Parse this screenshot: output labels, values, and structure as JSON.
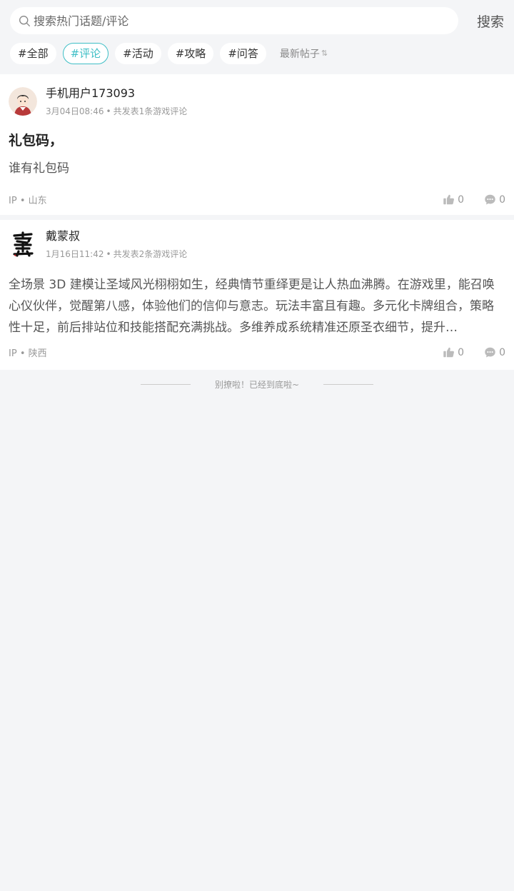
{
  "search": {
    "placeholder": "搜索热门话题/评论",
    "button_label": "搜索"
  },
  "tags": [
    {
      "label": "#全部",
      "active": false
    },
    {
      "label": "#评论",
      "active": true
    },
    {
      "label": "#活动",
      "active": false
    },
    {
      "label": "#攻略",
      "active": false
    },
    {
      "label": "#问答",
      "active": false
    }
  ],
  "sort": {
    "label": "最新帖子"
  },
  "posts": [
    {
      "author": "手机用户173093",
      "time": "3月04日08:46",
      "stats": "共发表1条游戏评论",
      "title": "礼包码，",
      "body": "谁有礼包码",
      "ip_label": "IP",
      "location": "山东",
      "likes": "0",
      "comments": "0"
    },
    {
      "author": "戴蒙叔",
      "time": "1月16日11:42",
      "stats": "共发表2条游戏评论",
      "title": "",
      "body": "全场景 3D 建模让圣域风光栩栩如生，经典情节重绎更是让人热血沸腾。在游戏里，能召唤心仪伙伴，觉醒第八感，体验他们的信仰与意志。玩法丰富且有趣。多元化卡牌组合，策略性十足，前后排站位和技能搭配充满挑战。多维养成系统精准还原圣衣细节，提升…",
      "ip_label": "IP",
      "location": "陕西",
      "likes": "0",
      "comments": "0"
    }
  ],
  "end_text": "别撩啦！已经到底啦~",
  "colors": {
    "accent": "#3fbfc6",
    "background": "#f4f5f7"
  }
}
